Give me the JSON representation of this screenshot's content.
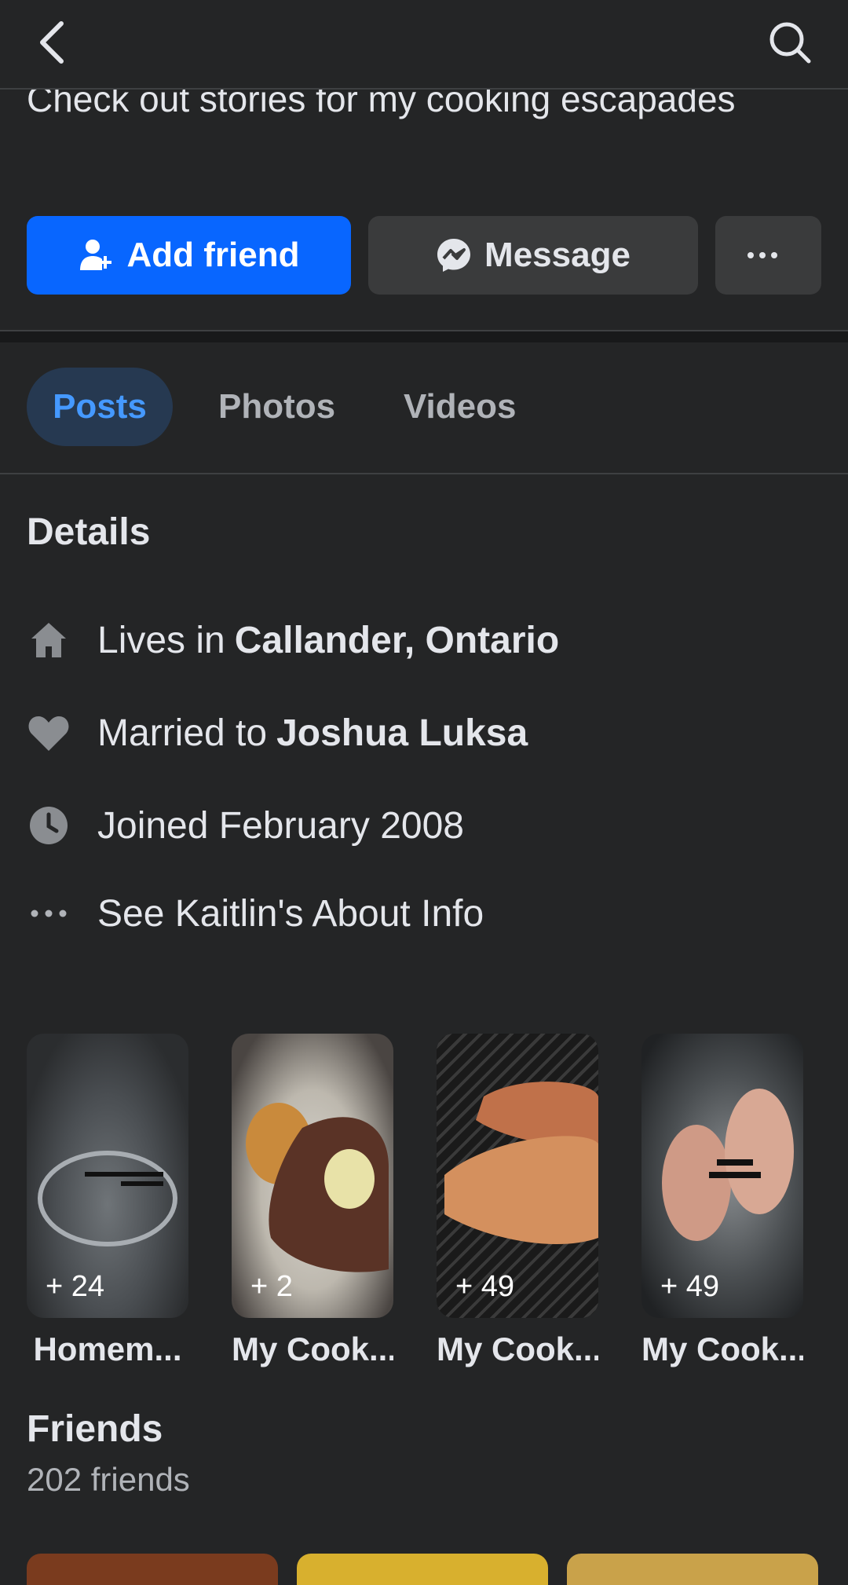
{
  "bio": "Check out stories for my cooking escapades",
  "buttons": {
    "add_friend": "Add friend",
    "message": "Message",
    "more": "···"
  },
  "tabs": [
    {
      "label": "Posts"
    },
    {
      "label": "Photos"
    },
    {
      "label": "Videos"
    }
  ],
  "details": {
    "title": "Details",
    "lives_prefix": "Lives in",
    "lives_value": "Callander, Ontario",
    "married_prefix": "Married to",
    "married_value": "Joshua Luksa",
    "joined": "Joined February 2008",
    "about": "See Kaitlin's About Info"
  },
  "stories": [
    {
      "count": "+ 24",
      "label": "Homem..."
    },
    {
      "count": "+ 2",
      "label": "My Cook..."
    },
    {
      "count": "+ 49",
      "label": "My Cook..."
    },
    {
      "count": "+ 49",
      "label": "My Cook..."
    }
  ],
  "friends": {
    "title": "Friends",
    "count": "202 friends"
  },
  "colors": {
    "primary": "#0866ff",
    "background": "#242526",
    "tab_active": "#4599ff"
  },
  "icons": [
    "back-arrow-icon",
    "search-icon",
    "add-person-icon",
    "messenger-icon",
    "home-icon",
    "heart-icon",
    "clock-icon",
    "dots-icon"
  ]
}
